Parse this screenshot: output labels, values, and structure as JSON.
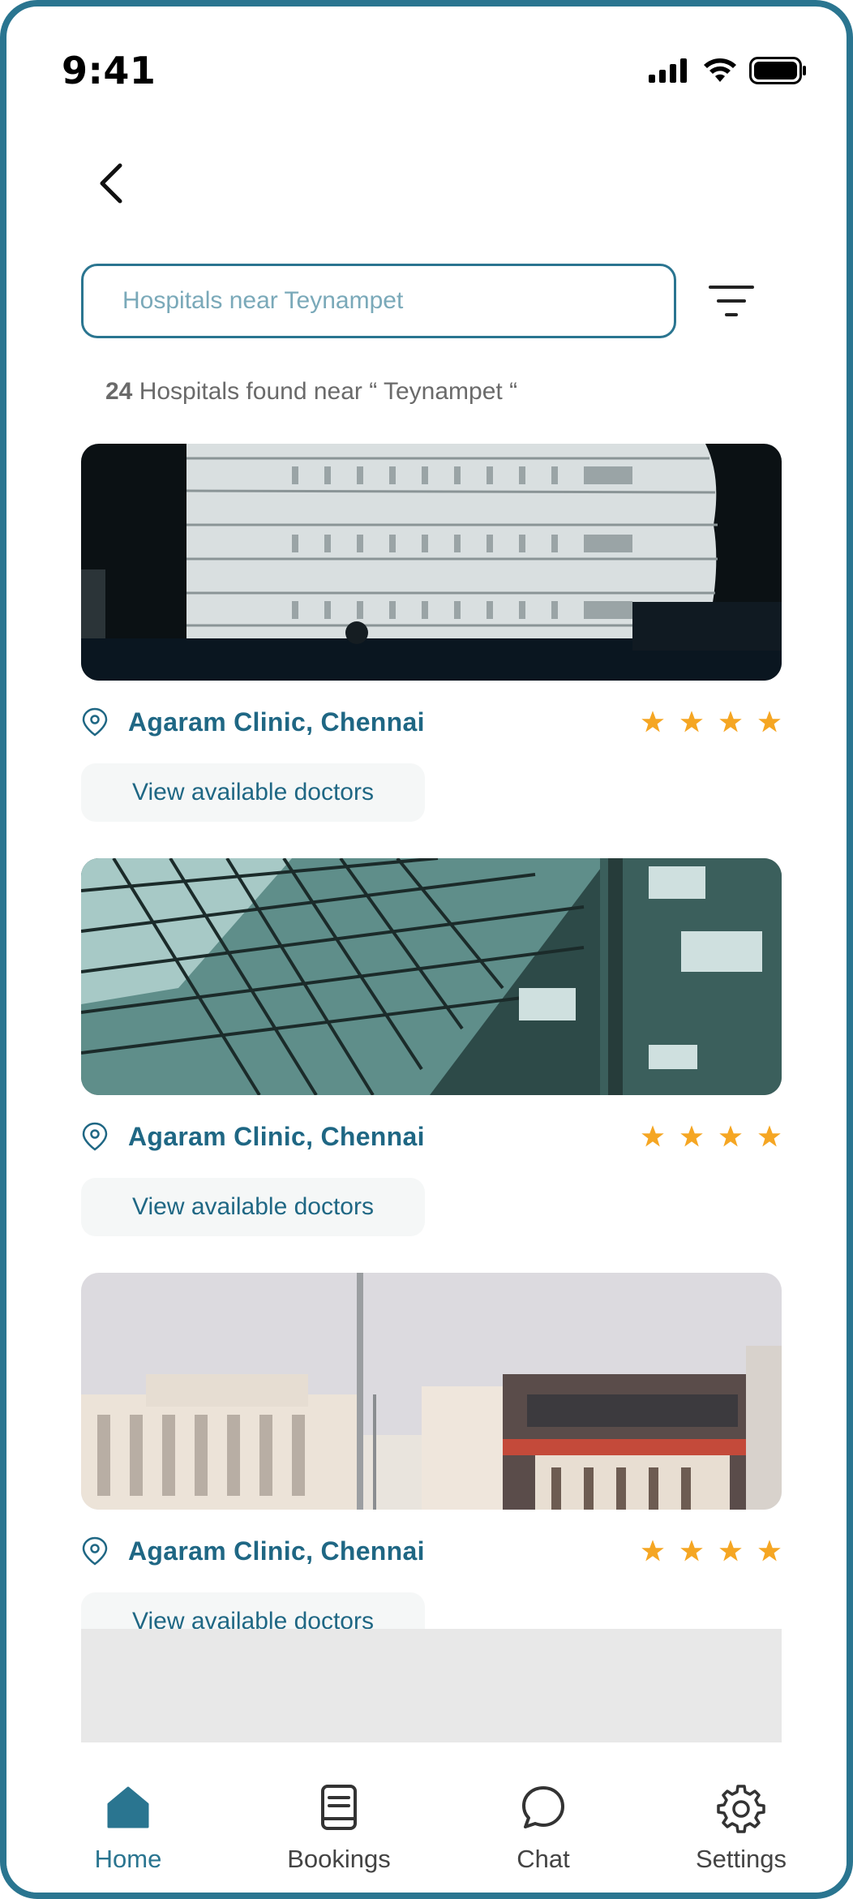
{
  "status_bar": {
    "time": "9:41"
  },
  "search": {
    "placeholder": "Hospitals near Teynampet"
  },
  "results": {
    "count": "24",
    "text": " Hospitals found near “ Teynampet “"
  },
  "hospitals": [
    {
      "name": "Agaram Clinic, Chennai",
      "rating": 4,
      "button_label": "View available doctors",
      "image": "modern-glass-building-night"
    },
    {
      "name": "Agaram Clinic, Chennai",
      "rating": 4,
      "button_label": "View available doctors",
      "image": "glass-roof-teal-building"
    },
    {
      "name": "Agaram Clinic, Chennai",
      "rating": 4,
      "button_label": "View available doctors",
      "image": "hospital-buildings-daylight"
    }
  ],
  "nav": [
    {
      "label": "Home",
      "icon": "home-icon",
      "active": true
    },
    {
      "label": "Bookings",
      "icon": "book-icon",
      "active": false
    },
    {
      "label": "Chat",
      "icon": "chat-icon",
      "active": false
    },
    {
      "label": "Settings",
      "icon": "gear-icon",
      "active": false
    }
  ],
  "colors": {
    "accent": "#2a7590",
    "star": "#f5a623",
    "text_link": "#1f6784"
  }
}
